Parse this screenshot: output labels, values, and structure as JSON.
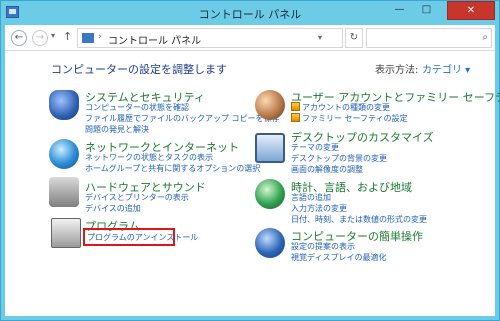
{
  "window": {
    "title": "コントロール パネル"
  },
  "titlebar": {
    "minimize": "—",
    "maximize": "□",
    "close": "✕"
  },
  "address_bar": {
    "path": "コントロール パネル"
  },
  "page": {
    "heading": "コンピューターの設定を調整します",
    "view_by_label": "表示方法:",
    "view_by_value": "カテゴリ ▾"
  },
  "categories": {
    "system_security": {
      "title": "システムとセキュリティ",
      "links": [
        "コンピューターの状態を確認",
        "ファイル履歴でファイルのバックアップ コピーを保存",
        "問題の発見と解決"
      ]
    },
    "network": {
      "title": "ネットワークとインターネット",
      "links": [
        "ネットワークの状態とタスクの表示",
        "ホームグループと共有に関するオプションの選択"
      ]
    },
    "hardware": {
      "title": "ハードウェアとサウンド",
      "links": [
        "デバイスとプリンターの表示",
        "デバイスの追加"
      ]
    },
    "programs": {
      "title": "プログラム",
      "links": [
        "プログラムのアンインストール"
      ]
    },
    "user_accounts": {
      "title": "ユーザー アカウントとファミリー セーフティ",
      "links": [
        "アカウントの種類の変更",
        "ファミリー セーフティの設定"
      ]
    },
    "appearance": {
      "title": "デスクトップのカスタマイズ",
      "links": [
        "テーマの変更",
        "デスクトップの背景の変更",
        "画面の解像度の調整"
      ]
    },
    "clock_region": {
      "title": "時計、言語、および地域",
      "links": [
        "言語の追加",
        "入力方法の変更",
        "日付、時刻、または数値の形式の変更"
      ]
    },
    "ease_of_access": {
      "title": "コンピューターの簡単操作",
      "links": [
        "設定の提案の表示",
        "視覚ディスプレイの最適化"
      ]
    }
  },
  "annotation": {
    "highlight_color": "#e01616"
  }
}
